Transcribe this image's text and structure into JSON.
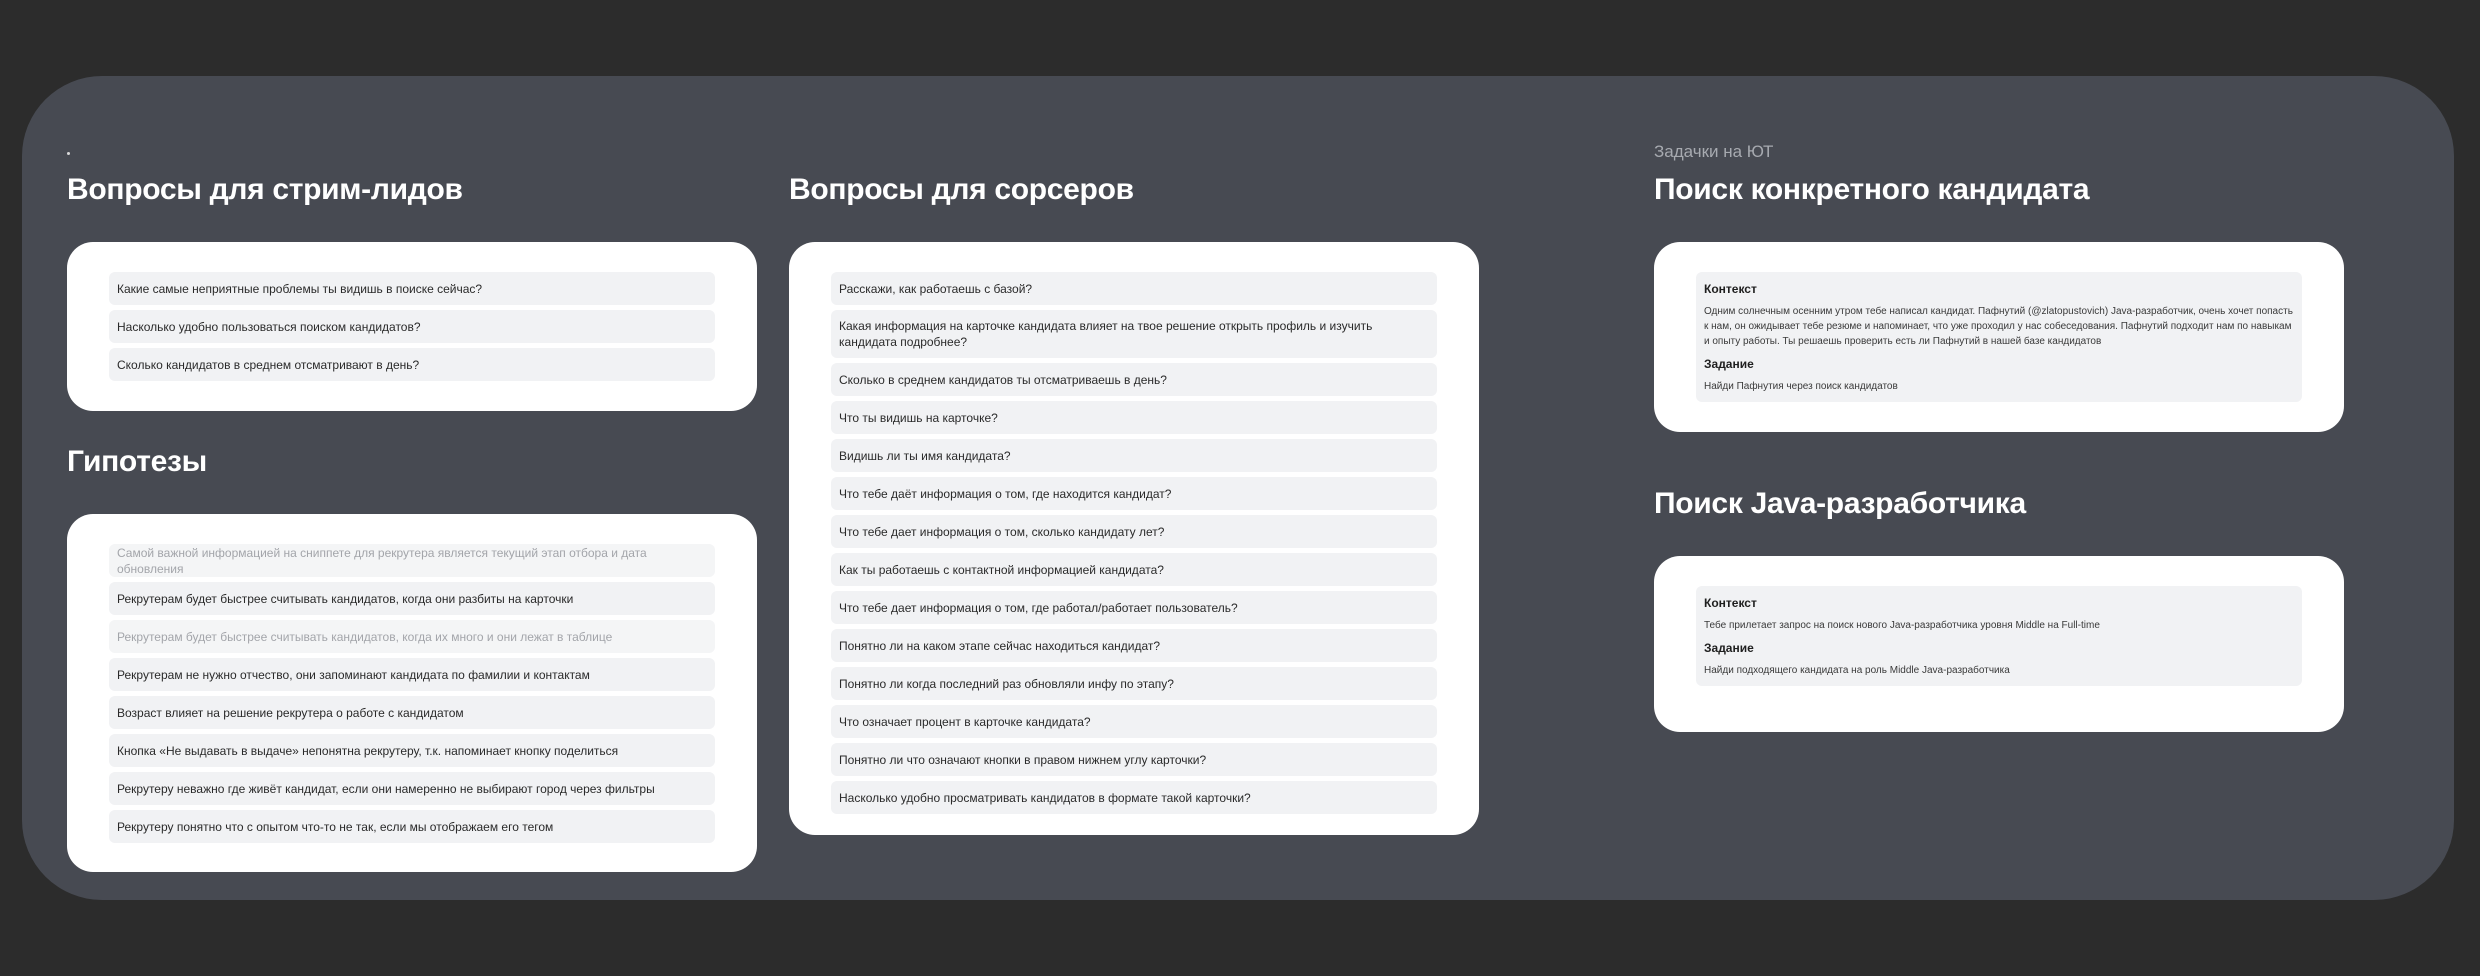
{
  "col1": {
    "heading": "Вопросы для стрим-лидов",
    "questions": [
      "Какие самые неприятные проблемы ты видишь в поиске сейчас?",
      "Насколько удобно пользоваться поиском кандидатов?",
      "Сколько кандидатов в среднем отсматривают в день?"
    ],
    "hyp_heading": "Гипотезы",
    "hypotheses": [
      "Самой важной информацией на сниппете для рекрутера является текущий этап отбора и дата обновления",
      "Рекрутерам будет быстрее считывать кандидатов, когда они разбиты на карточки",
      "Рекрутерам будет быстрее считывать кандидатов, когда их много и они лежат в таблице",
      "Рекрутерам не нужно отчество, они запоминают кандидата по фамилии и контактам",
      "Возраст влияет на решение рекрутера о работе с кандидатом",
      "Кнопка «Не выдавать в выдаче» непонятна рекрутеру, т.к. напоминает кнопку поделиться",
      "Рекрутеру неважно где живёт кандидат, если они намеренно не выбирают город через фильтры",
      "Рекрутеру понятно что с опытом что-то не так, если мы отображаем его тегом"
    ]
  },
  "col2": {
    "heading": "Вопросы для сорсеров",
    "questions": [
      "Расскажи, как работаешь с базой?",
      "Какая информация на карточке кандидата влияет на твое решение открыть профиль и изучить кандидата подробнее?",
      "Сколько в среднем кандидатов ты отсматриваешь в день?",
      "Что ты видишь на карточке?",
      "Видишь ли ты имя кандидата?",
      "Что тебе даёт информация о том, где находится кандидат?",
      "Что тебе дает информация о том, сколько кандидату лет?",
      "Как ты работаешь с контактной информацией кандидата?",
      "Что тебе дает информация о том, где работал/работает пользователь?",
      "Понятно ли на каком этапе сейчас находиться кандидат?",
      "Понятно ли когда последний раз обновляли инфу по этапу?",
      "Что означает процент в карточке кандидата?",
      "Понятно ли что означают кнопки в правом нижнем углу карточки?",
      "Насколько удобно просматривать кандидатов в формате такой карточки?"
    ]
  },
  "col3": {
    "eyebrow": "Задачки на ЮТ",
    "task1": {
      "heading": "Поиск конкретного кандидата",
      "context_title": "Контекст",
      "context_text": "Одним солнечным осенним утром тебе написал кандидат. Пафнутий (@zlatopustovich)  Java-разработчик, очень хочет попасть к нам, он ожидывает тебе резюме и напоминает, что уже проходил у нас собеседования. Пафнутий подходит нам по навыкам и опыту работы. Ты решаешь проверить есть ли Пафнутий в нашей базе кандидатов",
      "task_title": "Задание",
      "task_text": "Найди Пафнутия через поиск кандидатов"
    },
    "task2": {
      "heading": "Поиск Java-разработчика",
      "context_title": "Контекст",
      "context_text": "Тебе прилетает запрос на поиск нового Java-разработчика уровня Middle на Full-time",
      "task_title": "Задание",
      "task_text": "Найди подходящего кандидата на роль Middle Java-разработчика"
    }
  }
}
